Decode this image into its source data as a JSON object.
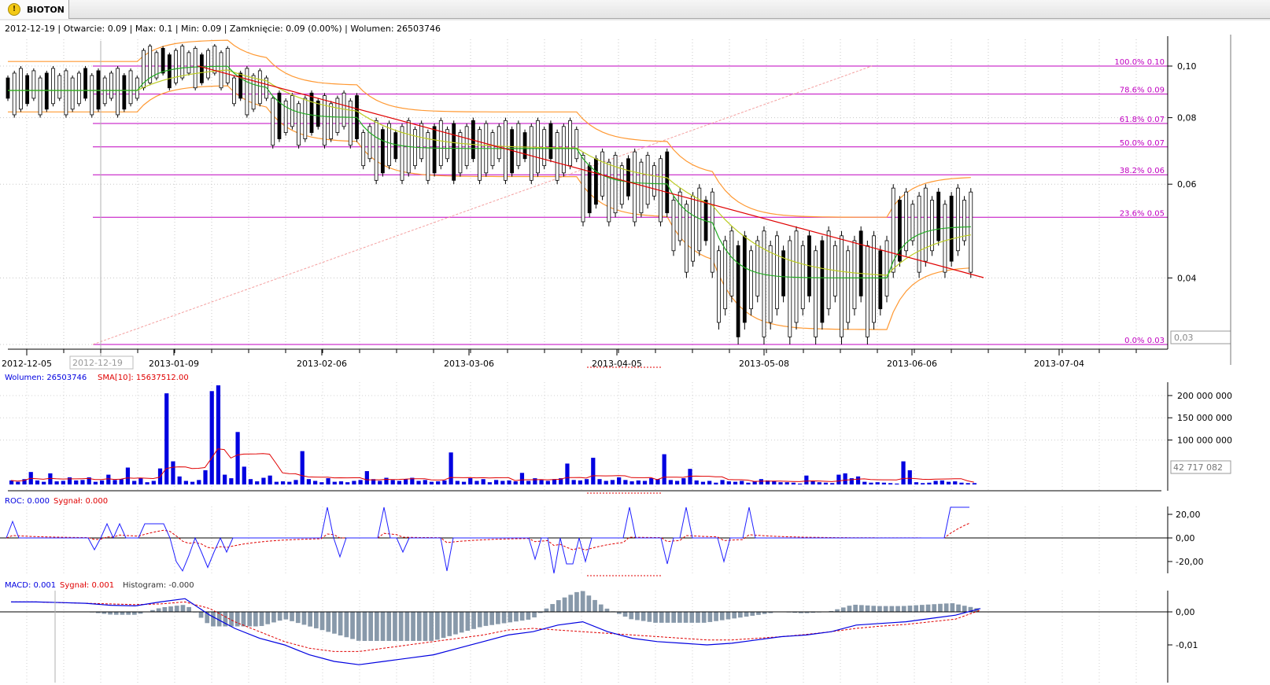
{
  "tab": {
    "label": "BIOTON",
    "icon": "warning-icon"
  },
  "header": {
    "date": "2012-12-19",
    "text": "2012-12-19 | Otwarcie: 0.09 | Max: 0.1 | Min: 0.09 | Zamknięcie: 0.09 (0.00%)  | Wolumen: 26503746"
  },
  "colors": {
    "fib": "#c000c0",
    "trend": "#e00000",
    "volume": "#0000e0",
    "sma": "#e00000",
    "roc": "#2020ff",
    "roc_signal": "#e00000",
    "macd": "#0000e0",
    "macd_signal": "#e00000",
    "histogram": "#8899aa",
    "orange": "#ff9933",
    "green": "#22aa22",
    "yellowgreen": "#bbcc22"
  },
  "price_panel": {
    "y_ticks": [
      "0,10",
      "0,08",
      "0,06",
      "0,04"
    ],
    "current_value": "0,03",
    "fib_levels": [
      {
        "label": "100.0% 0.10",
        "price": 0.1
      },
      {
        "label": "78.6% 0.09",
        "price": 0.0886
      },
      {
        "label": "61.8% 0.07",
        "price": 0.078
      },
      {
        "label": "50.0% 0.07",
        "price": 0.0705
      },
      {
        "label": "38.2% 0.06",
        "price": 0.0625
      },
      {
        "label": "23.6% 0.05",
        "price": 0.052
      },
      {
        "label": "0.0% 0.03",
        "price": 0.03
      }
    ]
  },
  "x_axis": {
    "labels": [
      "2012-12-05",
      "2013-01-09",
      "2013-02-06",
      "2013-03-06",
      "2013-04-05",
      "2013-05-08",
      "2013-06-06",
      "2013-07-04"
    ],
    "cursor_label": "2012-12-19"
  },
  "volume_panel": {
    "label": "Wolumen: 26503746",
    "sma_label": "SMA[10]: 15637512.00",
    "y_ticks": [
      "200 000 000",
      "150 000 000",
      "100 000 000"
    ],
    "current_value": "42 717 082"
  },
  "roc_panel": {
    "label": "ROC: 0.000",
    "signal_label": "Sygnał: 0.000",
    "y_ticks": [
      "20,00",
      "0,00",
      "-20,00"
    ]
  },
  "macd_panel": {
    "label": "MACD: 0.001",
    "signal_label": "Sygnał: 0.001",
    "histogram_label": "Histogram: -0.000",
    "y_ticks": [
      "0,00",
      "-0,01"
    ]
  },
  "chart_data": {
    "type": "candlestick",
    "symbol": "BIOTON",
    "x": [
      "2012-12-05",
      "2013-01-09",
      "2013-02-06",
      "2013-03-06",
      "2013-04-05",
      "2013-05-08",
      "2013-06-06",
      "2013-07-04"
    ],
    "ylim": [
      0.03,
      0.1
    ],
    "close_levels": [
      0.09,
      0.09,
      0.09,
      0.1,
      0.1,
      0.09,
      0.08,
      0.08,
      0.07,
      0.07,
      0.07,
      0.07,
      0.07,
      0.06,
      0.06,
      0.05,
      0.04,
      0.04,
      0.04,
      0.04,
      0.05,
      0.05
    ],
    "volume_ylim": [
      0,
      230000000
    ],
    "volumes": [
      9,
      6,
      12,
      28,
      9,
      6,
      25,
      7,
      8,
      16,
      9,
      10,
      16,
      6,
      9,
      22,
      10,
      12,
      38,
      8,
      14,
      5,
      8,
      36,
      205,
      52,
      18,
      8,
      6,
      10,
      32,
      210,
      223,
      22,
      14,
      118,
      40,
      12,
      7,
      15,
      20,
      6,
      7,
      6,
      10,
      75,
      12,
      8,
      5,
      14,
      6,
      7,
      5,
      8,
      10,
      30,
      12,
      8,
      15,
      10,
      8,
      12,
      15,
      8,
      10,
      6,
      7,
      9,
      72,
      8,
      6,
      14,
      8,
      12,
      5,
      10,
      8,
      9,
      7,
      26,
      8,
      14,
      10,
      8,
      12,
      14,
      47,
      10,
      9,
      12,
      60,
      12,
      8,
      10,
      16,
      10,
      7,
      9,
      8,
      14,
      12,
      68,
      10,
      8,
      14,
      35,
      9,
      6,
      8,
      4,
      10,
      7,
      6,
      8,
      4,
      7,
      12,
      9,
      8,
      5,
      5,
      4,
      2,
      20,
      8,
      5,
      4,
      3,
      22,
      25,
      14,
      18,
      6,
      4,
      5,
      4,
      3,
      2,
      52,
      32,
      5,
      3,
      4,
      8,
      9,
      6,
      7,
      4,
      3,
      3
    ],
    "roc": [
      0,
      14,
      0,
      0,
      0,
      0,
      0,
      0,
      0,
      0,
      0,
      0,
      0,
      0,
      -10,
      0,
      12,
      0,
      12,
      0,
      0,
      0,
      12,
      12,
      12,
      12,
      0,
      -20,
      -28,
      -15,
      0,
      -12,
      -25,
      -12,
      0,
      -12,
      0,
      0,
      0,
      0,
      0,
      0,
      0,
      0,
      0,
      0,
      0,
      0,
      0,
      0,
      0,
      26,
      0,
      -16,
      0,
      0,
      0,
      0,
      0,
      0,
      26,
      0,
      0,
      -12,
      0,
      0,
      0,
      0,
      0,
      0,
      -28,
      0,
      0,
      0,
      0,
      0,
      0,
      0,
      0,
      0,
      0,
      0,
      0,
      0,
      -18,
      0,
      0,
      -30,
      0,
      -22,
      -22,
      0,
      -20,
      0,
      0,
      0,
      0,
      0,
      0,
      26,
      0,
      0,
      0,
      0,
      0,
      -22,
      0,
      0,
      26,
      0,
      0,
      0,
      0,
      0,
      -20,
      0,
      0,
      0,
      26,
      0,
      0,
      0,
      0,
      0,
      0,
      0,
      0,
      0,
      0,
      0,
      0,
      0,
      0,
      0,
      0,
      0,
      0,
      0,
      0,
      0,
      0,
      0,
      0,
      0,
      0,
      0,
      0,
      0,
      0,
      0,
      26,
      26,
      26,
      26
    ],
    "roc_ylim": [
      -30,
      30
    ],
    "macd_ylim": [
      -0.016,
      0.006
    ],
    "macd": [
      0.003,
      0.003,
      0.0028,
      0.0026,
      0.002,
      0.0018,
      0.003,
      0.004,
      -0.001,
      -0.005,
      -0.008,
      -0.01,
      -0.013,
      -0.015,
      -0.016,
      -0.015,
      -0.014,
      -0.013,
      -0.011,
      -0.009,
      -0.007,
      -0.006,
      -0.004,
      -0.003,
      -0.006,
      -0.008,
      -0.009,
      -0.0095,
      -0.01,
      -0.0095,
      -0.0085,
      -0.0075,
      -0.007,
      -0.006,
      -0.004,
      -0.0035,
      -0.003,
      -0.002,
      -0.001,
      0.001
    ],
    "macd_signal": [
      0.003,
      0.003,
      0.0028,
      0.0026,
      0.0024,
      0.0022,
      0.0024,
      0.003,
      0.001,
      -0.003,
      -0.006,
      -0.009,
      -0.011,
      -0.012,
      -0.012,
      -0.011,
      -0.01,
      -0.009,
      -0.008,
      -0.007,
      -0.0055,
      -0.005,
      -0.0055,
      -0.006,
      -0.0065,
      -0.007,
      -0.0075,
      -0.008,
      -0.0085,
      -0.0085,
      -0.008,
      -0.0075,
      -0.0068,
      -0.006,
      -0.005,
      -0.0043,
      -0.0038,
      -0.003,
      -0.0022,
      0.0005
    ]
  }
}
